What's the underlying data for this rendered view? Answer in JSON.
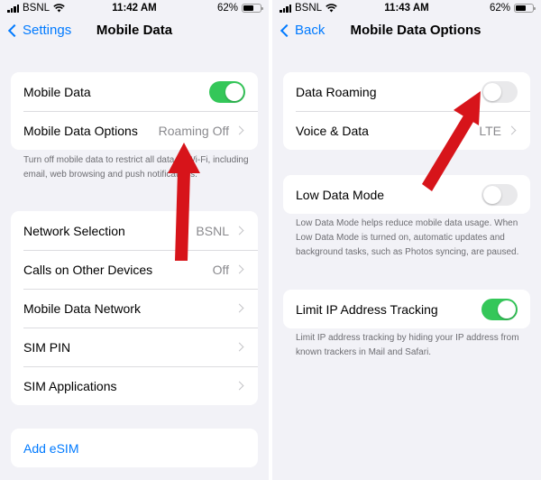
{
  "left": {
    "status": {
      "carrier": "BSNL",
      "time": "11:42 AM",
      "battery": "62%",
      "battery_level": 0.62
    },
    "nav": {
      "back_label": "Settings",
      "title": "Mobile Data"
    },
    "group1": {
      "mobile_data": {
        "label": "Mobile Data",
        "toggle_on": true
      },
      "options": {
        "label": "Mobile Data Options",
        "value": "Roaming Off"
      }
    },
    "footnote": "Turn off mobile data to restrict all data to Wi-Fi, including email, web browsing and push notifications.",
    "group2": [
      {
        "label": "Network Selection",
        "value": "BSNL"
      },
      {
        "label": "Calls on Other Devices",
        "value": "Off"
      },
      {
        "label": "Mobile Data Network",
        "value": ""
      },
      {
        "label": "SIM PIN",
        "value": ""
      },
      {
        "label": "SIM Applications",
        "value": ""
      }
    ],
    "esim": "Add eSIM"
  },
  "right": {
    "status": {
      "carrier": "BSNL",
      "time": "11:43 AM",
      "battery": "62%",
      "battery_level": 0.62
    },
    "nav": {
      "back_label": "Back",
      "title": "Mobile Data Options"
    },
    "group1": {
      "roaming": {
        "label": "Data Roaming",
        "toggle_on": false
      },
      "voice": {
        "label": "Voice & Data",
        "value": "LTE"
      }
    },
    "low_data": {
      "label": "Low Data Mode",
      "toggle_on": false
    },
    "low_data_note": "Low Data Mode helps reduce mobile data usage. When Low Data Mode is turned on, automatic updates and background tasks, such as Photos syncing, are paused.",
    "limit_ip": {
      "label": "Limit IP Address Tracking",
      "toggle_on": true
    },
    "limit_ip_note": "Limit IP address tracking by hiding your IP address from known trackers in Mail and Safari."
  },
  "colors": {
    "accent": "#007aff",
    "toggle_on": "#34c759",
    "annotation_arrow": "#d7141a"
  }
}
